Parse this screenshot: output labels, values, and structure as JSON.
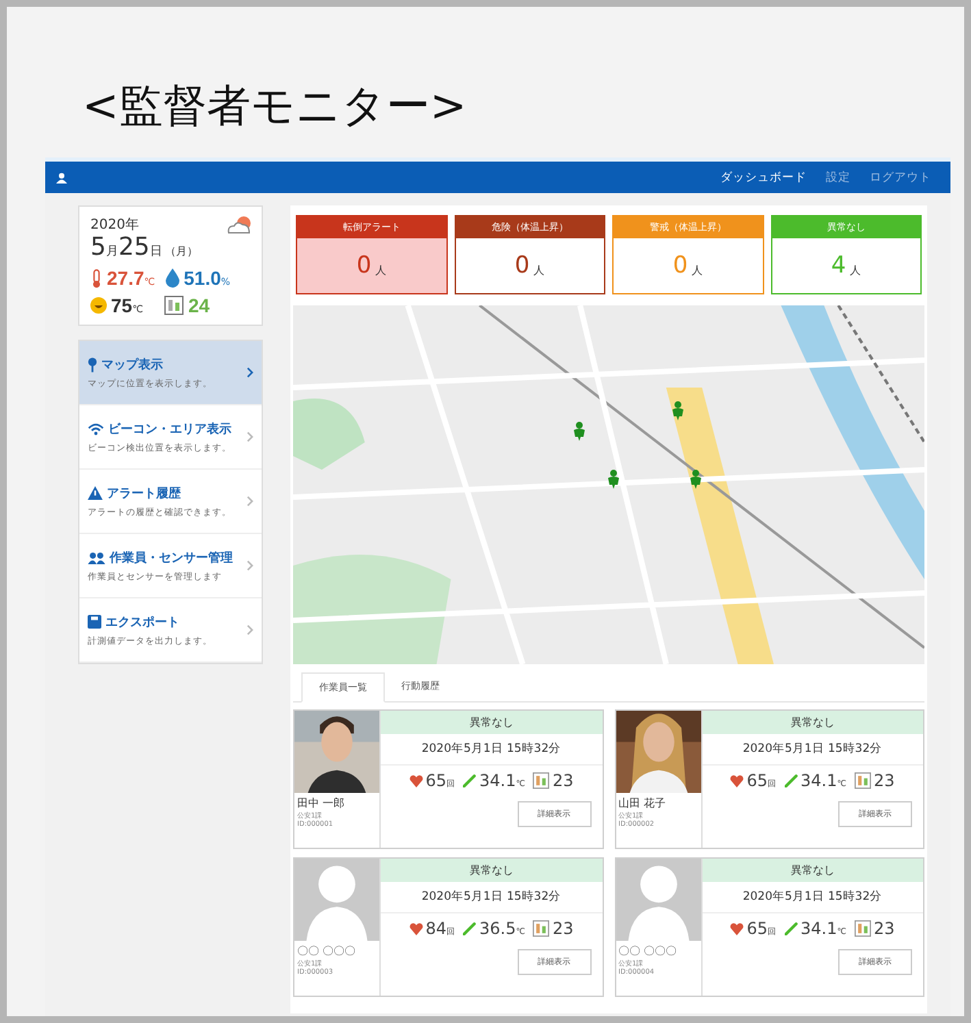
{
  "title": "<監督者モニター>",
  "header": {
    "links": [
      {
        "label": "ダッシュボード",
        "selected": true
      },
      {
        "label": "設定",
        "selected": false
      },
      {
        "label": "ログアウト",
        "selected": false
      }
    ]
  },
  "weather": {
    "year": "2020年",
    "month": "5",
    "month_unit": "月",
    "day": "25",
    "day_unit": "日",
    "weekday": "（月）",
    "temperature": "27.7",
    "temperature_unit": "℃",
    "humidity": "51.0",
    "humidity_unit": "%",
    "discomfort": "75",
    "discomfort_unit": "℃",
    "wbgt": "24"
  },
  "nav": [
    {
      "kind": "pin",
      "title": "マップ表示",
      "description": "マップに位置を表示します。",
      "selected": true
    },
    {
      "kind": "wifi",
      "title": "ビーコン・エリア表示",
      "description": "ビーコン検出位置を表示します。",
      "selected": false
    },
    {
      "kind": "warning",
      "title": "アラート履歴",
      "description": "アラートの履歴と確認できます。",
      "selected": false
    },
    {
      "kind": "people",
      "title": "作業員・センサー管理",
      "description": "作業員とセンサーを管理します",
      "selected": false
    },
    {
      "kind": "save",
      "title": "エクスポート",
      "description": "計測値データを出力します。",
      "selected": false
    }
  ],
  "alerts": [
    {
      "label": "転倒アラート",
      "count": "0",
      "unit": "人",
      "color": "#c8351c",
      "highlighted": true
    },
    {
      "label": "危険（体温上昇）",
      "count": "0",
      "unit": "人",
      "color": "#a83a1a",
      "highlighted": false
    },
    {
      "label": "警戒（体温上昇）",
      "count": "0",
      "unit": "人",
      "color": "#f0921c",
      "highlighted": false
    },
    {
      "label": "異常なし",
      "count": "4",
      "unit": "人",
      "color": "#4cbb2c",
      "highlighted": false
    }
  ],
  "map": {
    "kind": "picture",
    "markers": [
      {
        "kind": "worker"
      },
      {
        "kind": "worker"
      },
      {
        "kind": "worker"
      },
      {
        "kind": "worker"
      }
    ]
  },
  "tabs": [
    {
      "label": "作業員一覧",
      "selected": true
    },
    {
      "label": "行動履歴",
      "selected": false
    }
  ],
  "workers": [
    {
      "status": "異常なし",
      "time": "2020年5月1日 15時32分",
      "heart": "65",
      "heart_unit": "回",
      "temp": "34.1",
      "temp_unit": "℃",
      "steps": "23",
      "name": "田中 一郎",
      "department": "公安1課",
      "id": "ID:000001",
      "button": "詳細表示"
    },
    {
      "status": "異常なし",
      "time": "2020年5月1日 15時32分",
      "heart": "65",
      "heart_unit": "回",
      "temp": "34.1",
      "temp_unit": "℃",
      "steps": "23",
      "name": "山田 花子",
      "department": "公安1課",
      "id": "ID:000002",
      "button": "詳細表示"
    },
    {
      "kind": "silhouette",
      "status": "異常なし",
      "time": "2020年5月1日 15時32分",
      "heart": "84",
      "heart_unit": "回",
      "temp": "36.5",
      "temp_unit": "℃",
      "steps": "23",
      "name": "〇〇 〇〇〇",
      "department": "公安1課",
      "id": "ID:000003",
      "button": "詳細表示"
    },
    {
      "kind": "silhouette",
      "status": "異常なし",
      "time": "2020年5月1日 15時32分",
      "heart": "65",
      "heart_unit": "回",
      "temp": "34.1",
      "temp_unit": "℃",
      "steps": "23",
      "name": "〇〇 〇〇〇",
      "department": "公安1課",
      "id": "ID:000004",
      "button": "詳細表示"
    }
  ]
}
